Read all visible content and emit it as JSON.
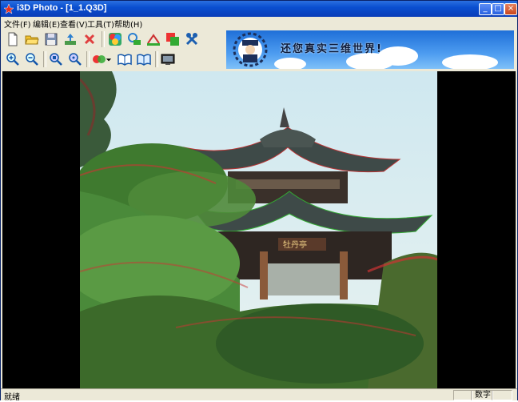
{
  "window": {
    "title": "i3D Photo - [1_1.Q3D]",
    "controls": {
      "minimize": "_",
      "maximize": "□",
      "close": "×"
    }
  },
  "menu": [
    {
      "label": "文件(F)"
    },
    {
      "label": "编辑(E)"
    },
    {
      "label": "查看(V)"
    },
    {
      "label": "工具(T)"
    },
    {
      "label": "帮助(H)"
    }
  ],
  "toolbar": {
    "row1": [
      "new-file-icon",
      "open-folder-icon",
      "save-icon",
      "export-icon",
      "delete-icon",
      "color-palette-icon",
      "anaglyph-convert-icon",
      "stereo-align-icon",
      "layers-icon",
      "tools-icon"
    ],
    "row2": [
      "zoom-in-icon",
      "zoom-out-icon",
      "fit-window-icon",
      "actual-size-icon",
      "anaglyph-mode-icon",
      "dropdown-arrow-icon",
      "book-open-icon",
      "book-flip-icon",
      "slideshow-icon"
    ]
  },
  "banner": {
    "text": "还您真实三维世界!",
    "colors": {
      "sky_top": "#1f6fd8",
      "sky_bottom": "#7fc0f8"
    }
  },
  "statusbar": {
    "left": "就绪",
    "panes": [
      "",
      "数字",
      ""
    ]
  }
}
